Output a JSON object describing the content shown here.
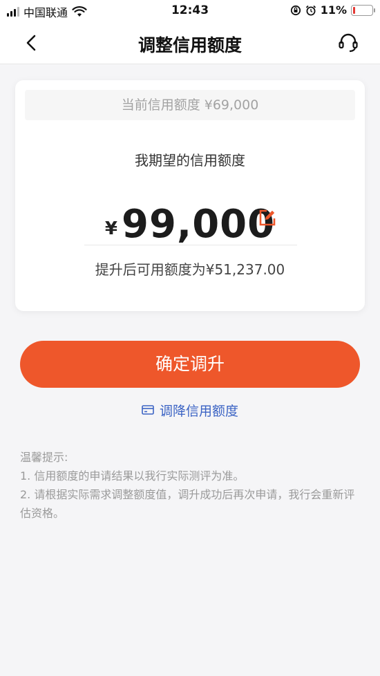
{
  "status_bar": {
    "carrier": "中国联通",
    "time": "12:43",
    "battery_pct": "11%",
    "battery_level": 0.11
  },
  "nav": {
    "title": "调整信用额度",
    "back_icon": "chevron-left-icon",
    "support_icon": "headset-icon"
  },
  "card": {
    "current_limit": "当前信用额度 ¥69,000",
    "expect_label": "我期望的信用额度",
    "currency_symbol": "¥",
    "amount": "99,000",
    "edit_icon": "edit-icon",
    "available_after": "提升后可用额度为¥51,237.00"
  },
  "actions": {
    "confirm_label": "确定调升",
    "decrease_label": "调降信用额度"
  },
  "tips": {
    "title": "温馨提示:",
    "items": [
      "1. 信用额度的申请结果以我行实际测评为准。",
      "2. 请根据实际需求调整额度值，调升成功后再次申请，我行会重新评估资格。"
    ]
  },
  "colors": {
    "accent": "#ee572b",
    "link": "#3b63c4",
    "edit_icon": "#ee572b"
  }
}
